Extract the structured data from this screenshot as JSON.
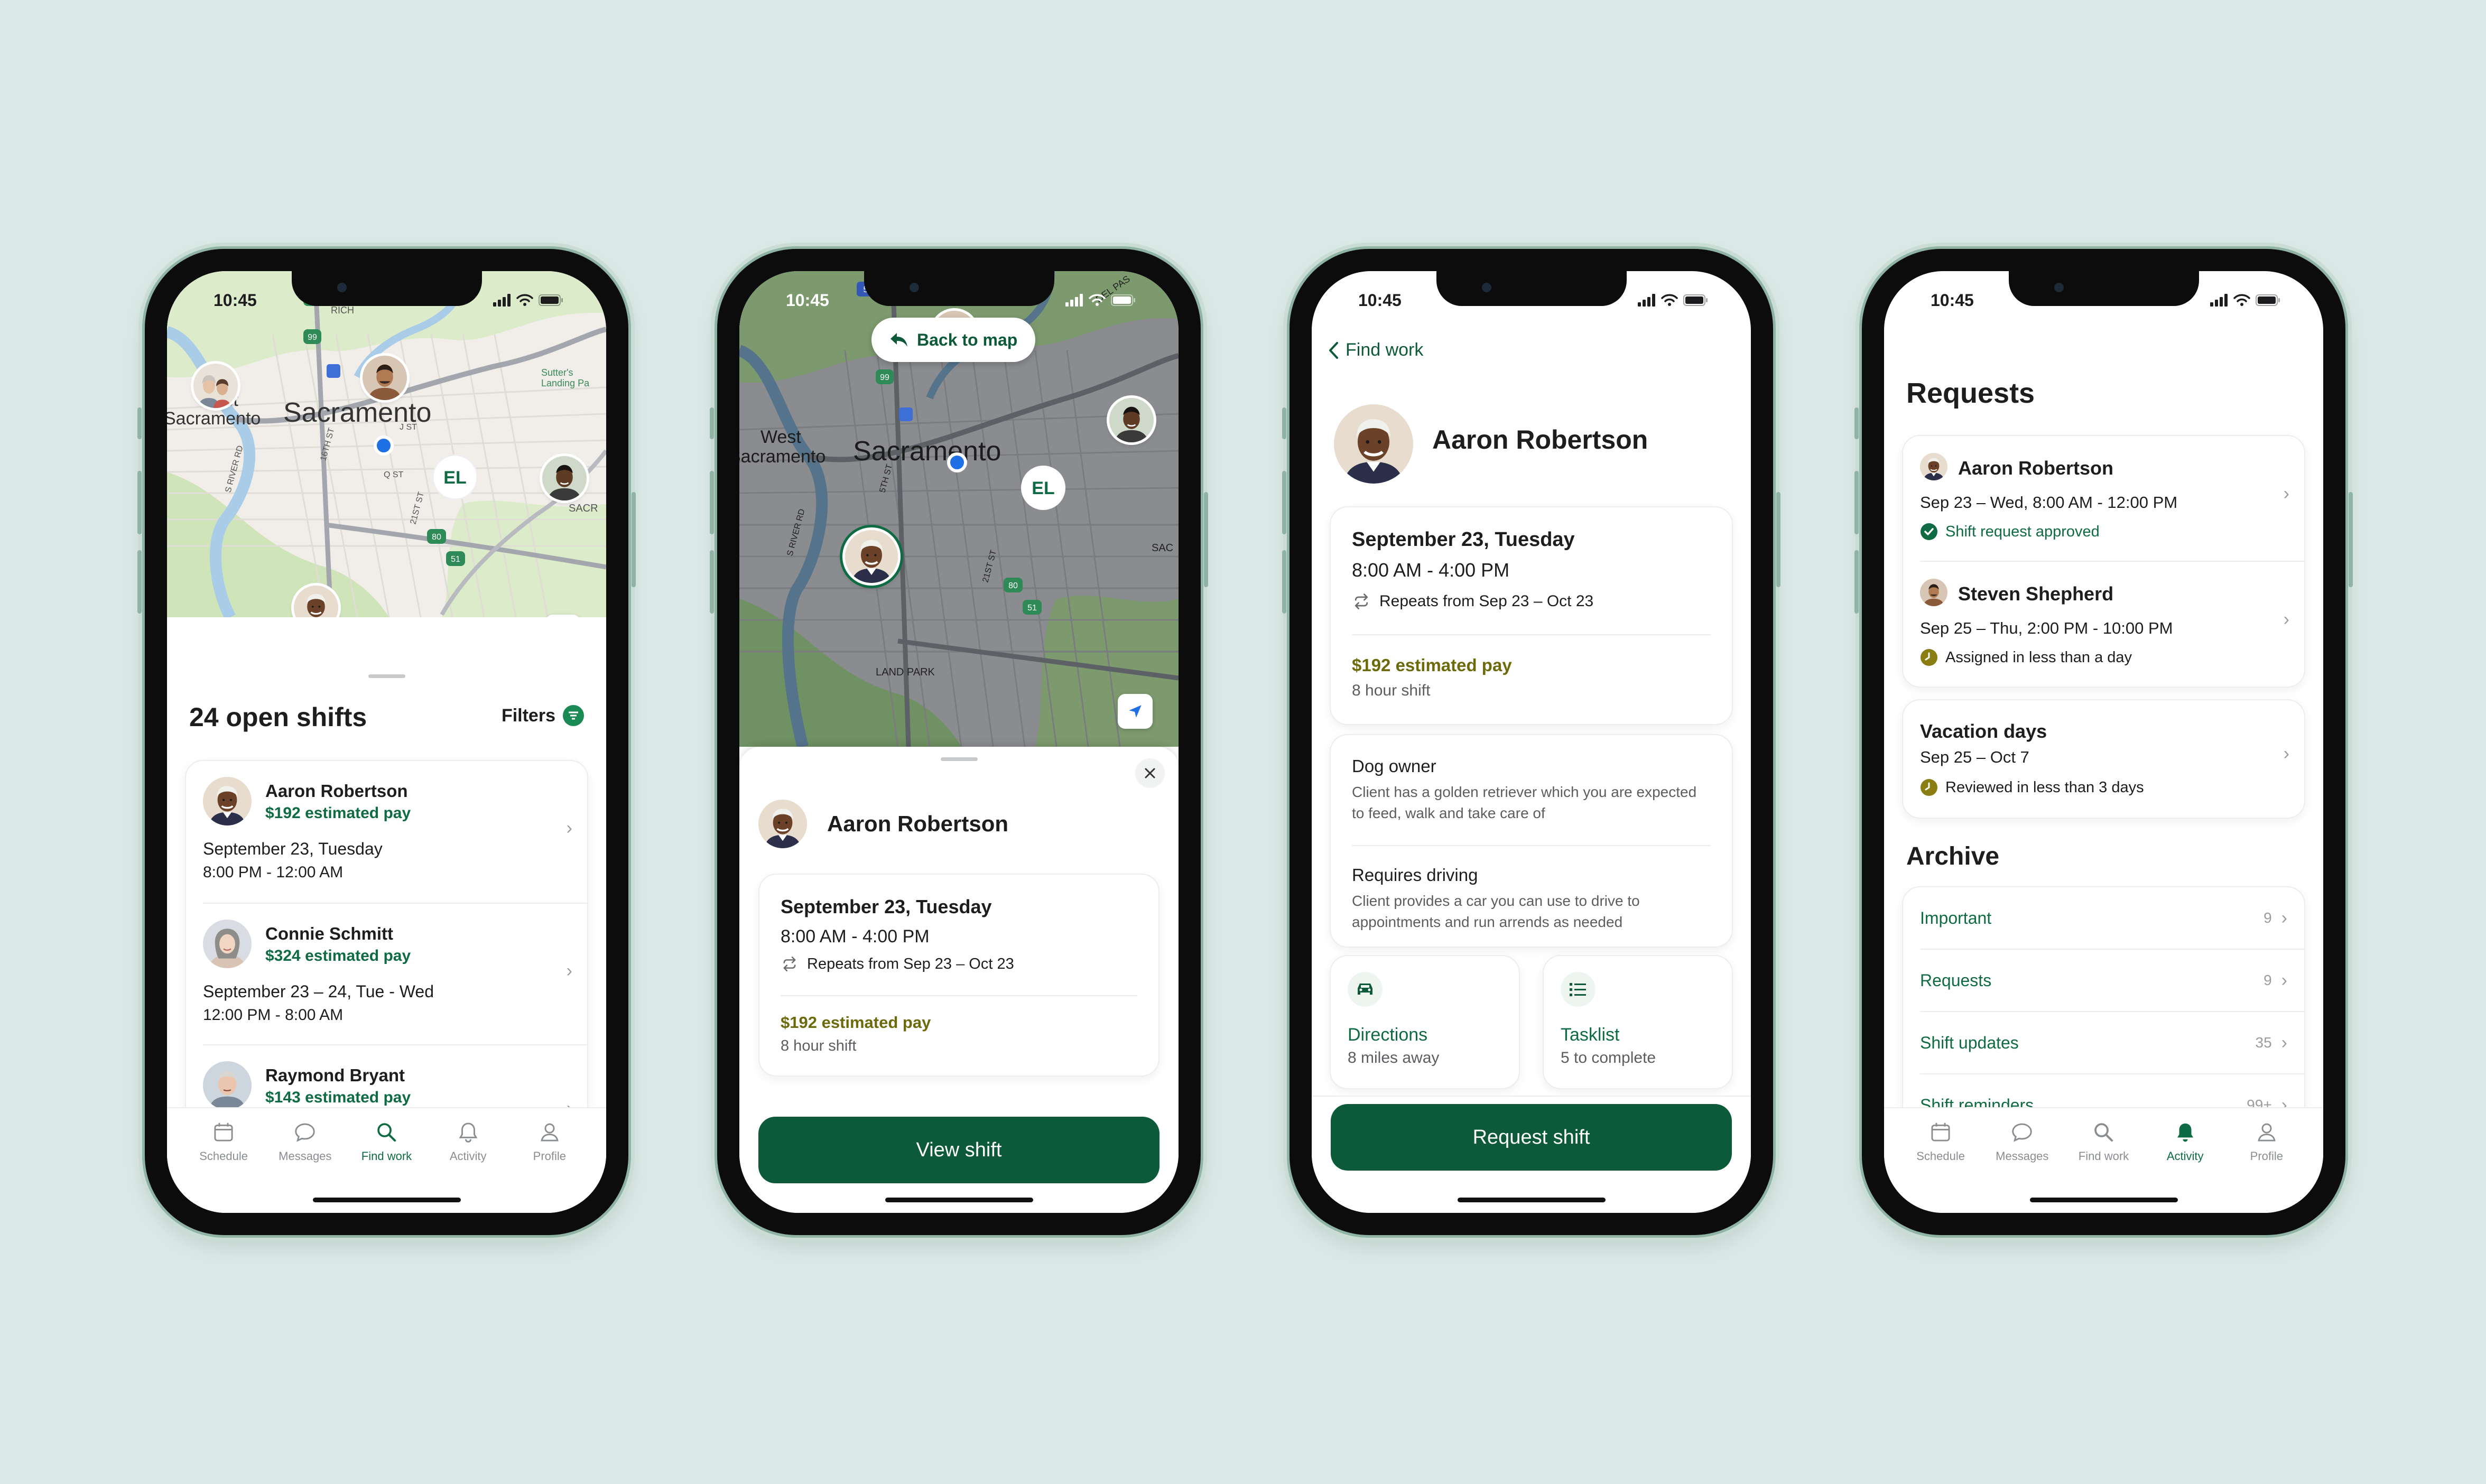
{
  "status_time": "10:45",
  "tabs": [
    "Schedule",
    "Messages",
    "Find work",
    "Activity",
    "Profile"
  ],
  "map_labels": {
    "west": "West",
    "west_sac": "Sacramento",
    "sacramento": "Sacramento",
    "el": "EL",
    "sutters": "Sutter's",
    "landing": "Landing Pa",
    "sacr": "SACR",
    "sac": "SAC",
    "land_park": "LAND PARK",
    "hwy_16": "16",
    "hwy_99": "99",
    "hwy_80": "80",
    "hwy_51": "51",
    "hwy_5": "5",
    "river_rd": "S RIVER RD",
    "st_16": "16TH ST",
    "st_5": "5TH ST",
    "st_21": "21ST ST",
    "st_j": "J ST",
    "st_q": "Q ST",
    "rich": "RICH",
    "del_paso": "DEL PAS"
  },
  "screen1": {
    "title": "24 open shifts",
    "filters": "Filters",
    "shifts": [
      {
        "name": "Aaron Robertson",
        "pay": "$192 estimated pay",
        "date": "September 23, Tuesday",
        "time": "8:00 PM - 12:00 AM"
      },
      {
        "name": "Connie Schmitt",
        "pay": "$324 estimated pay",
        "date": "September 23 – 24, Tue - Wed",
        "time": "12:00 PM - 8:00 AM"
      },
      {
        "name": "Raymond Bryant",
        "pay": "$143 estimated pay"
      }
    ]
  },
  "screen2": {
    "back": "Back to map",
    "name": "Aaron Robertson",
    "date": "September 23, Tuesday",
    "time": "8:00 AM - 4:00 PM",
    "repeats": "Repeats from Sep 23 – Oct 23",
    "pay": "$192 estimated pay",
    "hours": "8 hour shift",
    "button": "View shift"
  },
  "screen3": {
    "back": "Find work",
    "name": "Aaron Robertson",
    "date": "September 23, Tuesday",
    "time": "8:00 AM - 4:00 PM",
    "repeats": "Repeats from Sep 23 – Oct 23",
    "pay": "$192 estimated pay",
    "hours": "8 hour shift",
    "dog_title": "Dog owner",
    "dog_text": "Client has a golden retriever which you are expected to feed, walk and take care of",
    "driving_title": "Requires driving",
    "driving_text": "Client provides a car you can use to drive to appointments and run arrends as needed",
    "directions_title": "Directions",
    "directions_sub": "8 miles away",
    "tasklist_title": "Tasklist",
    "tasklist_sub": "5 to complete",
    "button": "Request shift"
  },
  "screen4": {
    "title": "Requests",
    "requests": [
      {
        "name": "Aaron Robertson",
        "detail": "Sep 23 – Wed, 8:00 AM - 12:00 PM",
        "status": "Shift request approved"
      },
      {
        "name": "Steven Shepherd",
        "detail": "Sep 25 – Thu, 2:00 PM - 10:00 PM",
        "status": "Assigned in less than a day"
      }
    ],
    "vacation": {
      "title": "Vacation days",
      "detail": "Sep 25 – Oct 7",
      "status": "Reviewed in less than 3 days"
    },
    "archive_title": "Archive",
    "archive": [
      {
        "label": "Important",
        "count": "9"
      },
      {
        "label": "Requests",
        "count": "9"
      },
      {
        "label": "Shift updates",
        "count": "35"
      },
      {
        "label": "Shift reminders",
        "count": "99+"
      }
    ]
  },
  "colors": {
    "brand_green": "#0d5a3a",
    "accent_green": "#0f6b43",
    "olive": "#6d6a0b",
    "background": "#dae9e6"
  }
}
